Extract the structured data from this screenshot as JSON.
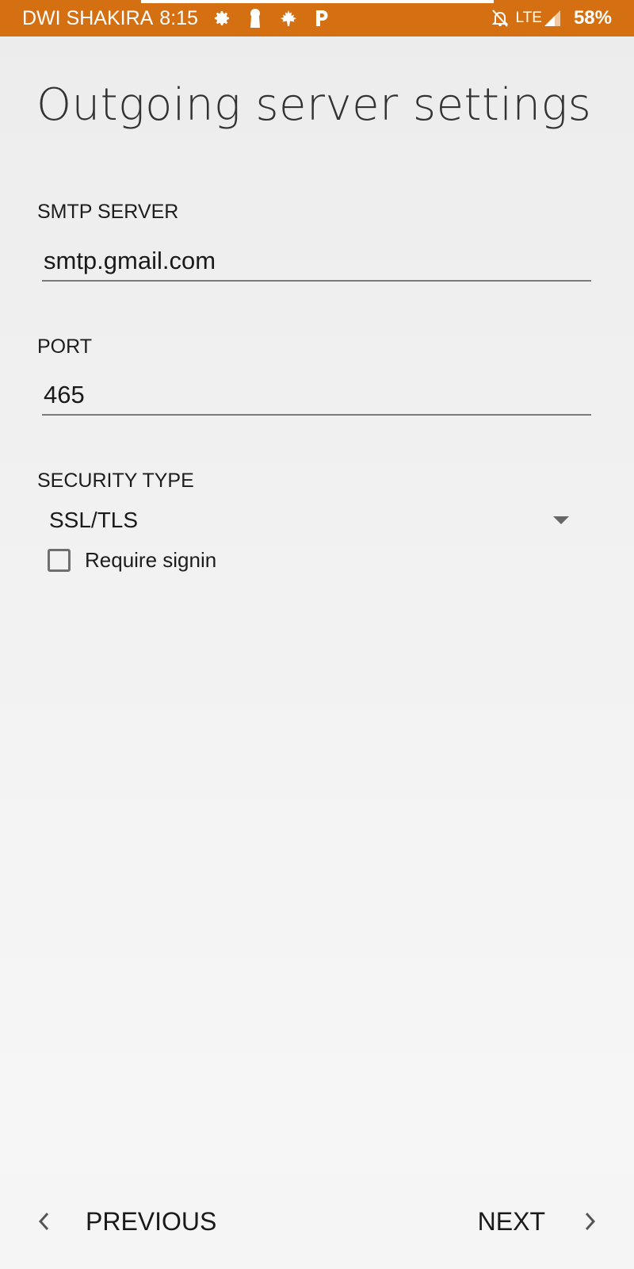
{
  "status_bar": {
    "carrier": "DWI SHAKIRA",
    "time": "8:15",
    "icons_left": [
      "gear-icon",
      "keyhole-icon",
      "maple-leaf-icon",
      "p-icon"
    ],
    "network": "LTE",
    "battery": "58%",
    "color": "#d46f12"
  },
  "page": {
    "title": "Outgoing server settings"
  },
  "smtp": {
    "label": "SMTP SERVER",
    "value": "smtp.gmail.com"
  },
  "port": {
    "label": "PORT",
    "value": "465"
  },
  "security": {
    "label": "SECURITY TYPE",
    "selected": "SSL/TLS"
  },
  "require_signin": {
    "label": "Require signin",
    "checked": false
  },
  "nav": {
    "previous_label": "PREVIOUS",
    "next_label": "NEXT"
  }
}
